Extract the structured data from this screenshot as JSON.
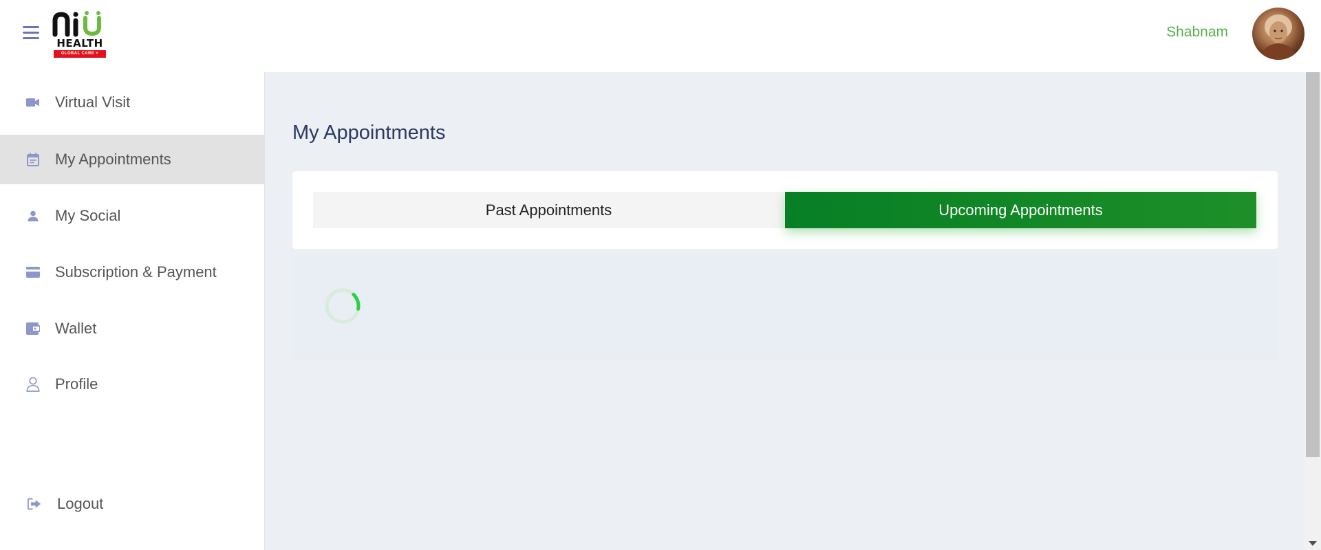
{
  "header": {
    "logo_text": "HEALTH",
    "logo_tagline": "GLOBAL CARE +",
    "username": "Shabnam",
    "colors": {
      "username": "#56b24b",
      "logo_green": "#6dbb3c",
      "logo_red": "#e1121b"
    }
  },
  "sidebar": {
    "items": [
      {
        "label": "Virtual Visit",
        "icon": "video-camera-icon",
        "active": false
      },
      {
        "label": "My Appointments",
        "icon": "calendar-icon",
        "active": true
      },
      {
        "label": "My Social",
        "icon": "person-icon",
        "active": false
      },
      {
        "label": "Subscription & Payment",
        "icon": "credit-card-icon",
        "active": false
      },
      {
        "label": "Wallet",
        "icon": "wallet-icon",
        "active": false
      },
      {
        "label": "Profile",
        "icon": "user-outline-icon",
        "active": false
      }
    ],
    "logout": {
      "label": "Logout",
      "icon": "logout-icon"
    },
    "colors": {
      "icon": "#8f97c9",
      "active_bg": "#e2e2e2"
    }
  },
  "main": {
    "title": "My Appointments",
    "tabs": [
      {
        "label": "Past Appointments",
        "active": false
      },
      {
        "label": "Upcoming Appointments",
        "active": true
      }
    ],
    "loading": true,
    "colors": {
      "active_tab": "#077f25",
      "background": "#ecf0f5",
      "title": "#2d3a60"
    }
  }
}
